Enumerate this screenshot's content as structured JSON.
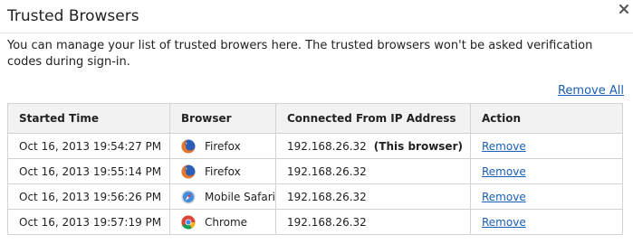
{
  "dialog": {
    "title": "Trusted Browsers",
    "close_icon": "close-icon",
    "description": "You can manage your list of trusted browers here. The trusted browsers won't be asked verification codes during sign-in.",
    "remove_all_label": "Remove All"
  },
  "table": {
    "headers": [
      "Started Time",
      "Browser",
      "Connected From IP Address",
      "Action"
    ],
    "rows": [
      {
        "time": "Oct 16, 2013 19:54:27 PM",
        "browser": "Firefox",
        "icon": "firefox-icon",
        "ip": "192.168.26.32",
        "note": "(This browser)",
        "action": "Remove"
      },
      {
        "time": "Oct 16, 2013 19:55:14 PM",
        "browser": "Firefox",
        "icon": "firefox-icon",
        "ip": "192.168.26.32",
        "note": "",
        "action": "Remove"
      },
      {
        "time": "Oct 16, 2013 19:56:26 PM",
        "browser": "Mobile Safari",
        "icon": "safari-icon",
        "ip": "192.168.26.32",
        "note": "",
        "action": "Remove"
      },
      {
        "time": "Oct 16, 2013 19:57:19 PM",
        "browser": "Chrome",
        "icon": "chrome-icon",
        "ip": "192.168.26.32",
        "note": "",
        "action": "Remove"
      }
    ]
  },
  "colors": {
    "link": "#1a5fb4",
    "header_bg": "#f2f2f2",
    "border": "#d3d3d3"
  }
}
